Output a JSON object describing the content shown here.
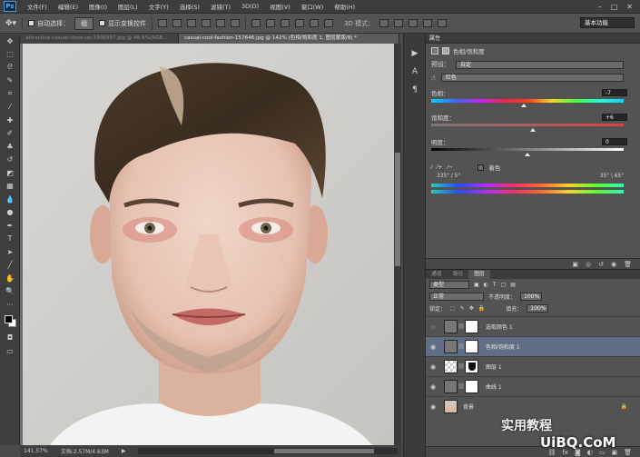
{
  "app": {
    "logo": "Ps"
  },
  "menu": [
    "文件(F)",
    "编辑(E)",
    "图像(I)",
    "图层(L)",
    "文字(Y)",
    "选择(S)",
    "滤镜(T)",
    "3D(D)",
    "视图(V)",
    "窗口(W)",
    "帮助(H)"
  ],
  "window_controls": [
    "–",
    "□",
    "✕"
  ],
  "options": {
    "auto_select_label": "自动选择：",
    "auto_select_value": "组",
    "show_transform_label": "显示变换控件",
    "mode_3d": "3D 模式：",
    "workspace": "基本功能"
  },
  "tabs": [
    {
      "label": "attractive-casual-close-up-1906997.jpg @ 48.8%(RGB...",
      "active": false
    },
    {
      "label": "casual-cool-fashion-157646.jpg @ 142% (色相/饱和度 1, 图层蒙版/8) *",
      "active": true
    }
  ],
  "status": {
    "zoom": "141.57%",
    "doc": "文档:2.57M/4.63M"
  },
  "properties": {
    "tab": "属性",
    "title": "色相/饱和度",
    "preset_label": "预设：",
    "preset_value": "自定",
    "channel_value": "红色",
    "hue_label": "色相：",
    "hue_value": "-7",
    "sat_label": "饱和度：",
    "sat_value": "+6",
    "light_label": "明度：",
    "light_value": "0",
    "colorize_label": "着色",
    "range_left": "335° / 5°",
    "range_right": "35° \\ 65°"
  },
  "adjust_levels": {
    "hue": 0.48,
    "sat": 0.53,
    "light": 0.5
  },
  "layers_panel": {
    "tabs": [
      "通道",
      "路径",
      "图层"
    ],
    "filter_value": "类型",
    "blend_value": "正常",
    "opacity_label": "不透明度：",
    "opacity_value": "100%",
    "lock_label": "锁定：",
    "fill_label": "填充：",
    "fill_value": "100%",
    "layers": [
      {
        "name": "选取颜色 1",
        "selected": false
      },
      {
        "name": "色相/饱和度 1",
        "selected": true
      },
      {
        "name": "图层 1",
        "selected": false
      },
      {
        "name": "曲线 1",
        "selected": false
      },
      {
        "name": "背景",
        "selected": false
      }
    ]
  },
  "watermark": {
    "line1": "实用教程",
    "line2": "UiBQ.CoM"
  }
}
